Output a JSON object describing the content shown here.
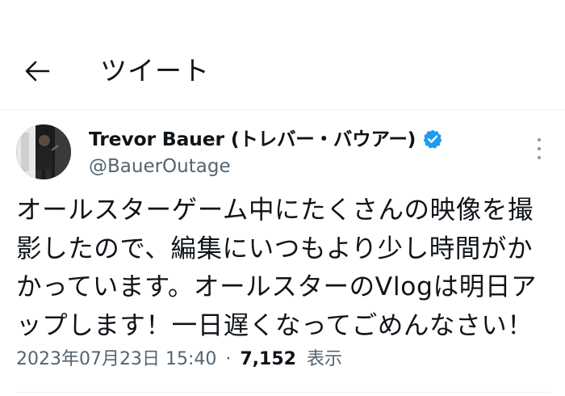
{
  "header": {
    "back_icon": "arrow-left-icon",
    "title": "ツイート"
  },
  "tweet": {
    "author": {
      "display_name": "Trevor Bauer (トレバー・バウアー)",
      "handle": "@BauerOutage",
      "verified": true,
      "verified_icon": "verified-badge-icon",
      "verified_color": "#1d9bf0"
    },
    "more_icon": "more-vertical-icon",
    "text": "オールスターゲーム中にたくさんの映像を撮\n影したので、編集にいつもより少し時間がか\nかっています。オールスターのVlogは明日ア\nップします！一日遅くなってごめんなさい！",
    "timestamp": "2023年07月23日 15:40",
    "separator": "·",
    "views_count": "7,152",
    "views_label": "表示"
  },
  "colors": {
    "text_primary": "#0f1419",
    "text_secondary": "#536471",
    "divider": "#eff3f4"
  }
}
